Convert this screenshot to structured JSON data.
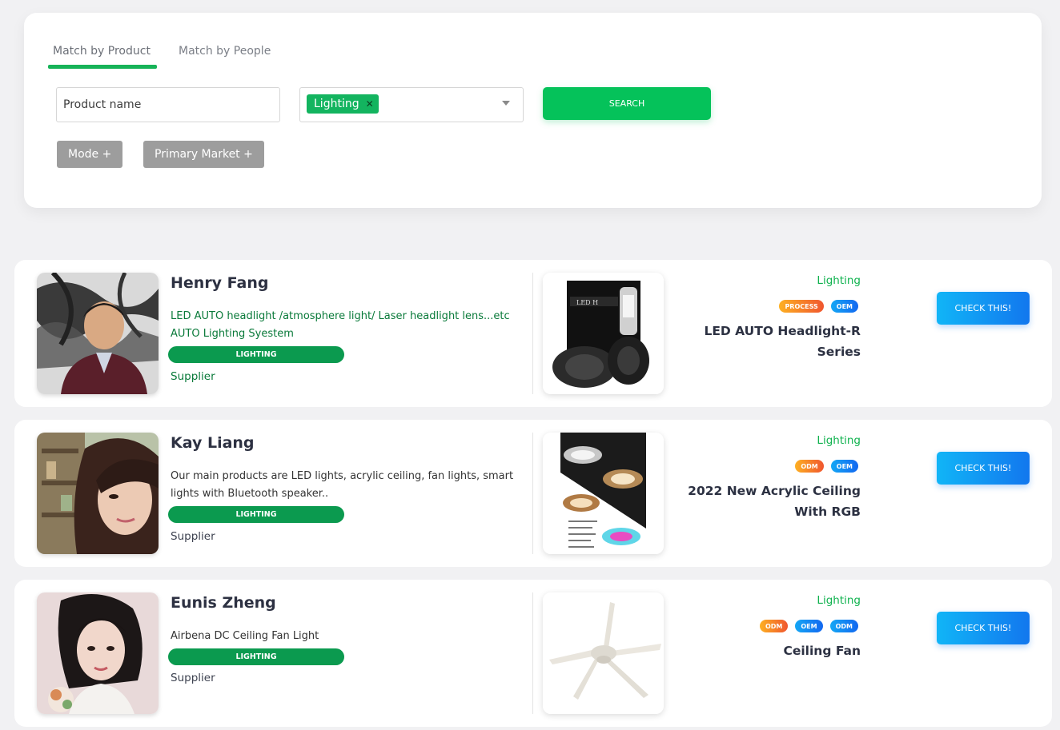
{
  "search": {
    "tabs": [
      {
        "label": "Match by Product",
        "active": true
      },
      {
        "label": "Match by People",
        "active": false
      }
    ],
    "product_placeholder": "Product name",
    "selected_category": "Lighting",
    "search_label": "SEARCH",
    "filters": [
      "Mode +",
      "Primary Market +"
    ]
  },
  "results": [
    {
      "name": "Henry Fang",
      "description": "LED AUTO headlight /atmosphere light/ Laser headlight lens...etc AUTO Lighting Syestem",
      "industry": "LIGHTING",
      "role": "Supplier",
      "category": "Lighting",
      "badges": [
        "PROCESS",
        "OEM"
      ],
      "product_title": "LED AUTO Headlight-R Series",
      "cta": "CHECK THIS!"
    },
    {
      "name": "Kay Liang",
      "description": "Our main products are LED lights, acrylic ceiling, fan lights, smart lights with Bluetooth speaker..",
      "industry": "LIGHTING",
      "role": "Supplier",
      "category": "Lighting",
      "badges": [
        "ODM",
        "OEM"
      ],
      "product_title": "2022 New Acrylic Ceiling With RGB",
      "cta": "CHECK THIS!"
    },
    {
      "name": "Eunis Zheng",
      "description": "Airbena DC Ceiling Fan Light",
      "industry": "LIGHTING",
      "role": "Supplier",
      "category": "Lighting",
      "badges": [
        "ODM",
        "OEM",
        "ODM"
      ],
      "product_title": "Ceiling Fan",
      "cta": "CHECK THIS!"
    }
  ],
  "colors": {
    "accent_green": "#05c25a",
    "pill_green": "#0b9a4f",
    "cta_blue": "#1277ee"
  }
}
